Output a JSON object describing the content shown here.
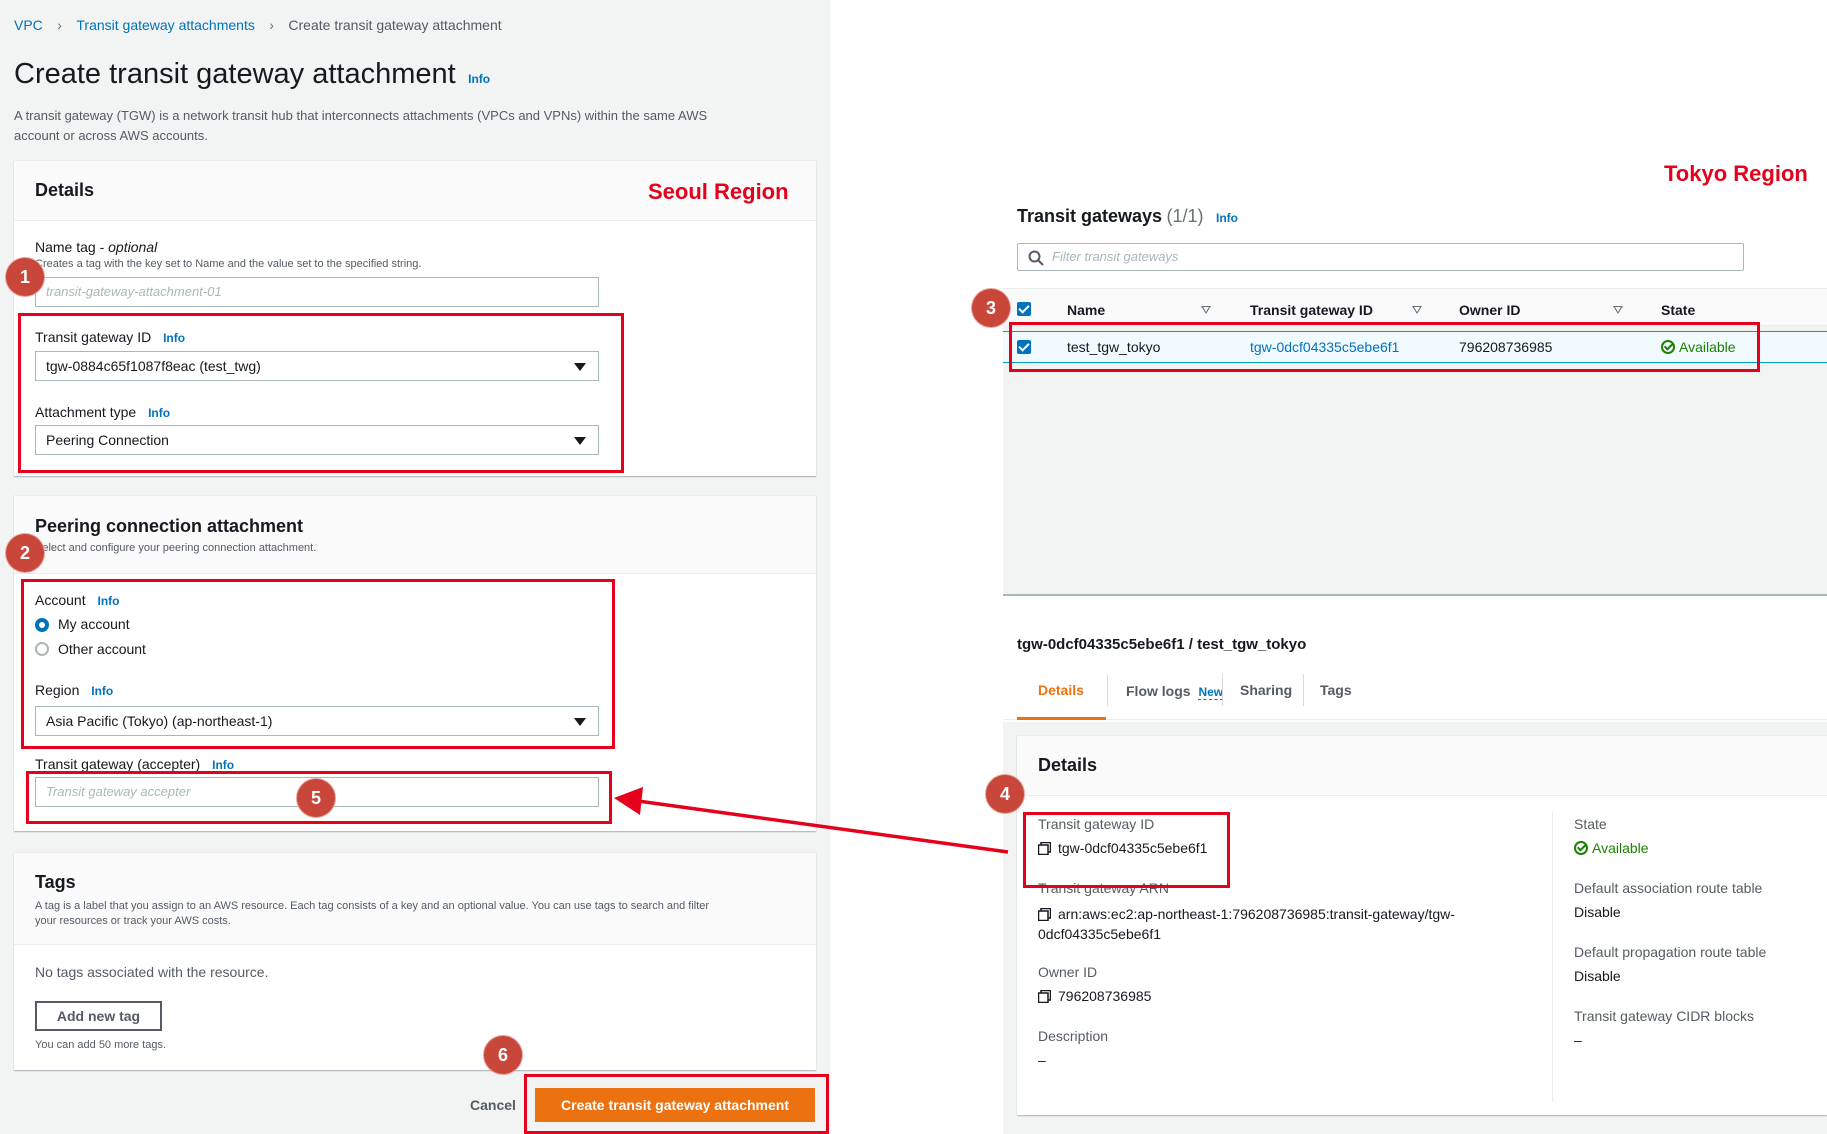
{
  "breadcrumb": {
    "items": [
      "VPC",
      "Transit gateway attachments"
    ],
    "current": "Create transit gateway attachment"
  },
  "page": {
    "title": "Create transit gateway attachment",
    "info": "Info",
    "description_line1": "A transit gateway (TGW) is a network transit hub that interconnects attachments (VPCs and VPNs) within the same AWS",
    "description_line2": "account or across AWS accounts."
  },
  "details": {
    "heading": "Details",
    "region_label": "Seoul Region",
    "name_tag_label": "Name tag - ",
    "name_tag_optional": "optional",
    "name_tag_desc": "Creates a tag with the key set to Name and the value set to the specified string.",
    "name_tag_placeholder": "transit-gateway-attachment-01",
    "tgw_id_label": "Transit gateway ID",
    "tgw_id_value": "tgw-0884c65f1087f8eac (test_twg)",
    "attachment_type_label": "Attachment type",
    "attachment_type_value": "Peering Connection",
    "info": "Info"
  },
  "peering": {
    "heading": "Peering connection attachment",
    "desc": "Select and configure your peering connection attachment.",
    "account_label": "Account",
    "my_account": "My account",
    "other_account": "Other account",
    "region_label": "Region",
    "region_value": "Asia Pacific (Tokyo) (ap-northeast-1)",
    "accepter_label": "Transit gateway (accepter)",
    "accepter_placeholder": "Transit gateway accepter",
    "info": "Info"
  },
  "tags": {
    "heading": "Tags",
    "desc_line1": "A tag is a label that you assign to an AWS resource. Each tag consists of a key and an optional value. You can use tags to search and filter",
    "desc_line2": "your resources or track your AWS costs.",
    "empty": "No tags associated with the resource.",
    "add_button": "Add new tag",
    "limit": "You can add 50 more tags."
  },
  "actions": {
    "cancel": "Cancel",
    "create": "Create transit gateway attachment"
  },
  "badges": [
    "1",
    "2",
    "3",
    "4",
    "5",
    "6"
  ],
  "tokyo": {
    "region_label": "Tokyo Region",
    "list_title": "Transit gateways",
    "list_count": "(1/1)",
    "info": "Info",
    "filter_placeholder": "Filter transit gateways",
    "columns": [
      "Name",
      "Transit gateway ID",
      "Owner ID",
      "State"
    ],
    "row": {
      "name": "test_tgw_tokyo",
      "id": "tgw-0dcf04335c5ebe6f1",
      "owner": "796208736985",
      "state": "Available"
    },
    "detail_title": "tgw-0dcf04335c5ebe6f1 / test_tgw_tokyo",
    "tabs": [
      "Details",
      "Flow logs",
      "Sharing",
      "Tags"
    ],
    "tab_new": "New",
    "details_heading": "Details",
    "tgw_id_label": "Transit gateway ID",
    "tgw_id_value": "tgw-0dcf04335c5ebe6f1",
    "arn_label": "Transit gateway ARN",
    "arn_line1": "arn:aws:ec2:ap-northeast-1:796208736985:transit-gateway/tgw-",
    "arn_line2": "0dcf04335c5ebe6f1",
    "owner_label": "Owner ID",
    "owner_value": "796208736985",
    "description_label": "Description",
    "description_value": "–",
    "state_label": "State",
    "state_value": "Available",
    "assoc_label": "Default association route table",
    "assoc_value": "Disable",
    "prop_label": "Default propagation route table",
    "prop_value": "Disable",
    "cidr_label": "Transit gateway CIDR blocks",
    "cidr_value": "–"
  },
  "colors": {
    "annotation_red": "#e5001b",
    "badge": "#c8463a",
    "link": "#0073bb",
    "primary_button": "#ec7211",
    "success": "#1d8102"
  }
}
